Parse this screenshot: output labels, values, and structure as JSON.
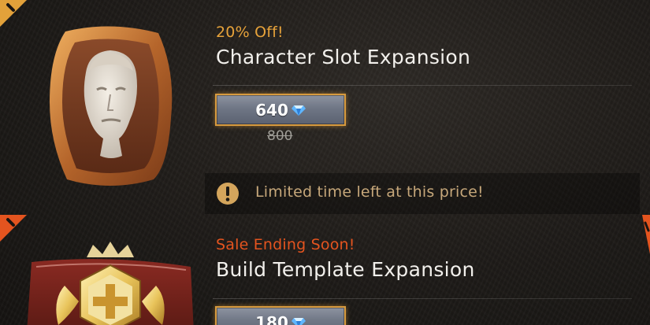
{
  "items": [
    {
      "badge": "20% Off!",
      "title": "Character Slot Expansion",
      "price": "640",
      "old_price": "800",
      "notice": "Limited time left at this price!",
      "badge_color": "#e6a23a"
    },
    {
      "badge": "Sale Ending Soon!",
      "title": "Build Template Expansion",
      "price": "180",
      "badge_color": "#e4541f"
    }
  ],
  "icons": [
    "exclamation-icon",
    "gem-icon",
    "warning-circle-icon",
    "character-face-icon",
    "build-template-emblem-icon"
  ],
  "colors": {
    "button_border": "#d79a3e",
    "button_fill": "#6f7685",
    "notice_text": "#c6a77a",
    "title_text": "#f2f0ec"
  }
}
